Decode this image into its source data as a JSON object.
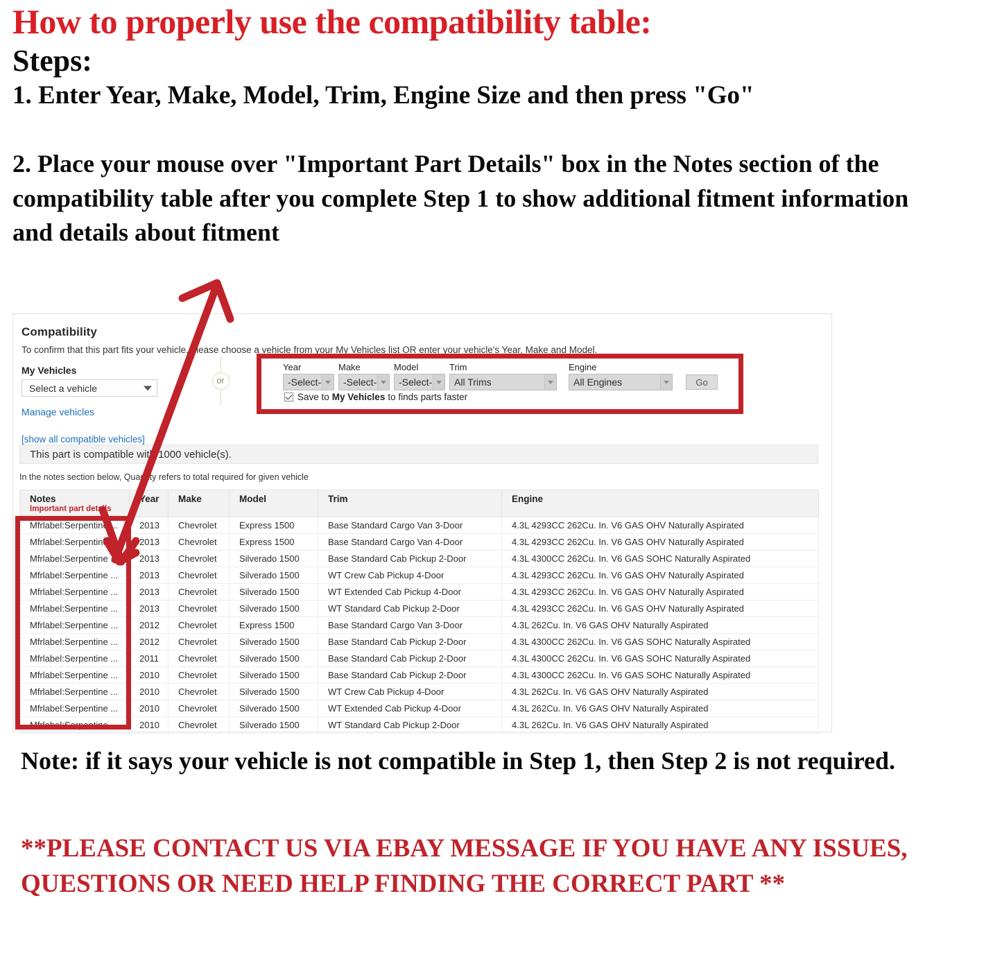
{
  "intro": {
    "title": "How to properly use the compatibility table:",
    "steps_heading": "Steps:",
    "step1": "1. Enter Year, Make, Model, Trim, Engine Size and then press \"Go\"",
    "step2": "2. Place your mouse over \"Important Part Details\" box in the Notes section of the compatibility table after you complete Step 1 to show additional fitment information and details about fitment"
  },
  "panel": {
    "title": "Compatibility",
    "subtitle": "To confirm that this part fits your vehicle, please choose a vehicle from your My Vehicles list OR enter your vehicle's Year, Make and Model.",
    "my_vehicles_label": "My Vehicles",
    "my_vehicles_value": "Select a vehicle",
    "manage_vehicles_link": "Manage vehicles",
    "show_all_link": "[show all compatible vehicles]",
    "or_label": "or",
    "compatible_banner": "This part is compatible with 1000 vehicle(s).",
    "quantity_note": "In the notes section below, Quantity refers to total required for given vehicle"
  },
  "form": {
    "year": {
      "label": "Year",
      "value": "-Select-"
    },
    "make": {
      "label": "Make",
      "value": "-Select-"
    },
    "model": {
      "label": "Model",
      "value": "-Select-"
    },
    "trim": {
      "label": "Trim",
      "value": "All Trims"
    },
    "engine": {
      "label": "Engine",
      "value": "All Engines"
    },
    "go_label": "Go",
    "save_prefix": "Save to",
    "save_bold": "My Vehicles",
    "save_suffix": "to finds parts faster"
  },
  "table": {
    "headers": {
      "notes": "Notes",
      "notes_sub": "Important part details",
      "year": "Year",
      "make": "Make",
      "model": "Model",
      "trim": "Trim",
      "engine": "Engine"
    },
    "rows": [
      {
        "notes": "Mfrlabel:Serpentine ...",
        "year": "2013",
        "make": "Chevrolet",
        "model": "Express 1500",
        "trim": "Base Standard Cargo Van 3-Door",
        "engine": "4.3L 4293CC 262Cu. In. V6 GAS OHV Naturally Aspirated"
      },
      {
        "notes": "Mfrlabel:Serpentine ...",
        "year": "2013",
        "make": "Chevrolet",
        "model": "Express 1500",
        "trim": "Base Standard Cargo Van 4-Door",
        "engine": "4.3L 4293CC 262Cu. In. V6 GAS OHV Naturally Aspirated"
      },
      {
        "notes": "Mfrlabel:Serpentine ...",
        "year": "2013",
        "make": "Chevrolet",
        "model": "Silverado 1500",
        "trim": "Base Standard Cab Pickup 2-Door",
        "engine": "4.3L 4300CC 262Cu. In. V6 GAS SOHC Naturally Aspirated"
      },
      {
        "notes": "Mfrlabel:Serpentine ...",
        "year": "2013",
        "make": "Chevrolet",
        "model": "Silverado 1500",
        "trim": "WT Crew Cab Pickup 4-Door",
        "engine": "4.3L 4293CC 262Cu. In. V6 GAS OHV Naturally Aspirated"
      },
      {
        "notes": "Mfrlabel:Serpentine ...",
        "year": "2013",
        "make": "Chevrolet",
        "model": "Silverado 1500",
        "trim": "WT Extended Cab Pickup 4-Door",
        "engine": "4.3L 4293CC 262Cu. In. V6 GAS OHV Naturally Aspirated"
      },
      {
        "notes": "Mfrlabel:Serpentine ...",
        "year": "2013",
        "make": "Chevrolet",
        "model": "Silverado 1500",
        "trim": "WT Standard Cab Pickup 2-Door",
        "engine": "4.3L 4293CC 262Cu. In. V6 GAS OHV Naturally Aspirated"
      },
      {
        "notes": "Mfrlabel:Serpentine ...",
        "year": "2012",
        "make": "Chevrolet",
        "model": "Express 1500",
        "trim": "Base Standard Cargo Van 3-Door",
        "engine": "4.3L 262Cu. In. V6 GAS OHV Naturally Aspirated"
      },
      {
        "notes": "Mfrlabel:Serpentine ...",
        "year": "2012",
        "make": "Chevrolet",
        "model": "Silverado 1500",
        "trim": "Base Standard Cab Pickup 2-Door",
        "engine": "4.3L 4300CC 262Cu. In. V6 GAS SOHC Naturally Aspirated"
      },
      {
        "notes": "Mfrlabel:Serpentine ...",
        "year": "2011",
        "make": "Chevrolet",
        "model": "Silverado 1500",
        "trim": "Base Standard Cab Pickup 2-Door",
        "engine": "4.3L 4300CC 262Cu. In. V6 GAS SOHC Naturally Aspirated"
      },
      {
        "notes": "Mfrlabel:Serpentine ...",
        "year": "2010",
        "make": "Chevrolet",
        "model": "Silverado 1500",
        "trim": "Base Standard Cab Pickup 2-Door",
        "engine": "4.3L 4300CC 262Cu. In. V6 GAS SOHC Naturally Aspirated"
      },
      {
        "notes": "Mfrlabel:Serpentine ...",
        "year": "2010",
        "make": "Chevrolet",
        "model": "Silverado 1500",
        "trim": "WT Crew Cab Pickup 4-Door",
        "engine": "4.3L 262Cu. In. V6 GAS OHV Naturally Aspirated"
      },
      {
        "notes": "Mfrlabel:Serpentine ...",
        "year": "2010",
        "make": "Chevrolet",
        "model": "Silverado 1500",
        "trim": "WT Extended Cab Pickup 4-Door",
        "engine": "4.3L 262Cu. In. V6 GAS OHV Naturally Aspirated"
      },
      {
        "notes": "Mfrlabel:Serpentine ...",
        "year": "2010",
        "make": "Chevrolet",
        "model": "Silverado 1500",
        "trim": "WT Standard Cab Pickup 2-Door",
        "engine": "4.3L 262Cu. In. V6 GAS OHV Naturally Aspirated"
      }
    ]
  },
  "footer": {
    "note": "Note: if it says your vehicle is not compatible in Step 1, then Step 2 is not required.",
    "contact": "**PLEASE CONTACT US VIA EBAY MESSAGE IF YOU HAVE ANY ISSUES, QUESTIONS OR NEED HELP FINDING THE CORRECT PART **"
  },
  "colors": {
    "red_accent": "#c0232a",
    "title_red": "#d81f26",
    "link_blue": "#1c6fba"
  }
}
